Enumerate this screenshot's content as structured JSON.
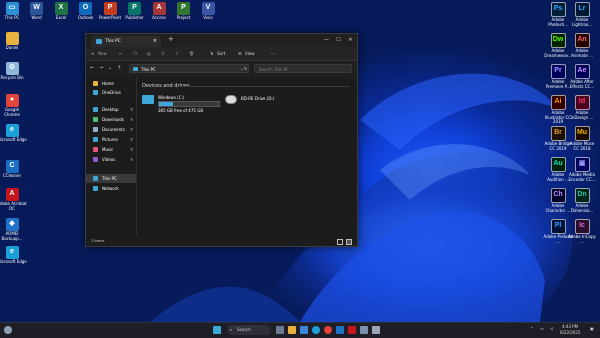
{
  "desktop": {
    "left_icons": [
      {
        "label": "This PC",
        "icon": "this-pc-icon",
        "color": "#2a8fd4",
        "glyph": "▭"
      },
      {
        "label": "Daniel",
        "icon": "folder-icon",
        "color": "#e8b33c",
        "glyph": ""
      },
      {
        "label": "Recycle Bin",
        "icon": "recycle-bin-icon",
        "color": "#8fb7d8",
        "glyph": "♲"
      },
      {
        "label": "Google Chrome",
        "icon": "chrome-icon",
        "color": "#e0443a",
        "glyph": "●"
      },
      {
        "label": "Microsoft Edge",
        "icon": "edge-icon",
        "color": "#1ba0d8",
        "glyph": "e"
      },
      {
        "label": "CCleaner",
        "icon": "ccleaner-icon",
        "color": "#1a6fc4",
        "glyph": "C"
      },
      {
        "label": "Adobe Acrobat DC",
        "icon": "acrobat-icon",
        "color": "#c4161c",
        "glyph": "A"
      },
      {
        "label": "AOMEI Backupp...",
        "icon": "aomei-icon",
        "color": "#1e73c8",
        "glyph": "◆"
      },
      {
        "label": "Microsoft Edge",
        "icon": "edge-icon",
        "color": "#1ba0d8",
        "glyph": "e"
      }
    ],
    "top_icons": [
      {
        "label": "This PC",
        "icon": "this-pc-icon",
        "color": "#2a8fd4",
        "glyph": "▭"
      },
      {
        "label": "Word",
        "icon": "word-icon",
        "color": "#2b579a",
        "glyph": "W"
      },
      {
        "label": "Excel",
        "icon": "excel-icon",
        "color": "#217346",
        "glyph": "X"
      },
      {
        "label": "Outlook",
        "icon": "outlook-icon",
        "color": "#0f6cbd",
        "glyph": "O"
      },
      {
        "label": "PowerPoint",
        "icon": "powerpoint-icon",
        "color": "#c43e1c",
        "glyph": "P"
      },
      {
        "label": "Publisher",
        "icon": "publisher-icon",
        "color": "#077568",
        "glyph": "P"
      },
      {
        "label": "Access",
        "icon": "access-icon",
        "color": "#a4373a",
        "glyph": "A"
      },
      {
        "label": "Project",
        "icon": "project-icon",
        "color": "#31752f",
        "glyph": "P"
      },
      {
        "label": "Visio",
        "icon": "visio-icon",
        "color": "#3955a3",
        "glyph": "V"
      }
    ],
    "right_col1": [
      {
        "label": "Adobe Photosh...",
        "abbr": "Ps",
        "bg": "#001e36",
        "fg": "#31a8ff"
      },
      {
        "label": "Adobe Dreamweav...",
        "abbr": "Dw",
        "bg": "#072401",
        "fg": "#4afe00"
      },
      {
        "label": "Adobe Premiere P...",
        "abbr": "Pr",
        "bg": "#00005b",
        "fg": "#9999ff"
      },
      {
        "label": "Adobe Illustrator CC 2019",
        "abbr": "Ai",
        "bg": "#330000",
        "fg": "#ff9a00"
      },
      {
        "label": "Adobe Bridge CC 2019",
        "abbr": "Br",
        "bg": "#1d1000",
        "fg": "#e99c2d"
      },
      {
        "label": "Adobe Audition ...",
        "abbr": "Au",
        "bg": "#00200d",
        "fg": "#00e4bb"
      },
      {
        "label": "Adobe Character ...",
        "abbr": "Ch",
        "bg": "#040027",
        "fg": "#bc8cff"
      },
      {
        "label": "Adobe Prelude ...",
        "abbr": "Pl",
        "bg": "#001238",
        "fg": "#2ea3ff"
      }
    ],
    "right_col2": [
      {
        "label": "Adobe Lightroo...",
        "abbr": "Lr",
        "bg": "#001a36",
        "fg": "#31a8ff"
      },
      {
        "label": "Adobe Animate ...",
        "abbr": "An",
        "bg": "#260000",
        "fg": "#ff5f5f"
      },
      {
        "label": "Adobe After Effects CC...",
        "abbr": "Ae",
        "bg": "#00005b",
        "fg": "#d291ff"
      },
      {
        "label": "Adobe InDesign ...",
        "abbr": "Id",
        "bg": "#49021f",
        "fg": "#ff3366"
      },
      {
        "label": "Adobe Muse CC 2018",
        "abbr": "Mu",
        "bg": "#1a0a00",
        "fg": "#e6b800"
      },
      {
        "label": "Adobe Media Encoder CC...",
        "abbr": "▣",
        "bg": "#00005b",
        "fg": "#9999ff"
      },
      {
        "label": "Adobe Dimensio...",
        "abbr": "Dn",
        "bg": "#00231b",
        "fg": "#1ac1a0"
      },
      {
        "label": "Adobe InCopy ...",
        "abbr": "Ic",
        "bg": "#2a0e30",
        "fg": "#e36bd7"
      }
    ]
  },
  "explorer": {
    "tab_title": "This PC",
    "new_tab": "+",
    "window_controls": [
      "—",
      "☐",
      "✕"
    ],
    "cmd": {
      "new": "New",
      "sort": "Sort",
      "view": "View",
      "more": "···"
    },
    "nav": {
      "back": "←",
      "forward": "→",
      "up": "↑",
      "refresh": "↻"
    },
    "address": "This PC",
    "search_placeholder": "Search This PC",
    "pane": [
      {
        "label": "Home",
        "icon": "home-icon",
        "color": "#e8b33c",
        "pin": ""
      },
      {
        "label": "OneDrive",
        "icon": "onedrive-icon",
        "color": "#3fa6d8",
        "pin": ""
      },
      {
        "label": "Desktop",
        "icon": "desktop-icon",
        "color": "#3fa6d8",
        "pin": "📌"
      },
      {
        "label": "Downloads",
        "icon": "downloads-icon",
        "color": "#4cc27a",
        "pin": "📌"
      },
      {
        "label": "Documents",
        "icon": "documents-icon",
        "color": "#9ab0c8",
        "pin": "📌"
      },
      {
        "label": "Pictures",
        "icon": "pictures-icon",
        "color": "#3fa6d8",
        "pin": "📌"
      },
      {
        "label": "Music",
        "icon": "music-icon",
        "color": "#e2577a",
        "pin": "📌"
      },
      {
        "label": "Videos",
        "icon": "videos-icon",
        "color": "#8c5cd6",
        "pin": "📌"
      },
      {
        "label": "This PC",
        "icon": "this-pc-icon",
        "color": "#3fa6d8",
        "pin": ""
      },
      {
        "label": "Network",
        "icon": "network-icon",
        "color": "#3fa6d8",
        "pin": ""
      }
    ],
    "section": "Devices and drives",
    "drive_c": {
      "name": "Windows (C:)",
      "free": "365 GB free of 475 GB",
      "used_fraction": 0.23
    },
    "drive_d": {
      "name": "BD-RE Drive (D:)"
    },
    "status": "2 items"
  },
  "taskbar": {
    "search": "Search",
    "time": "4:43 PM",
    "date": "6/22/2025"
  }
}
